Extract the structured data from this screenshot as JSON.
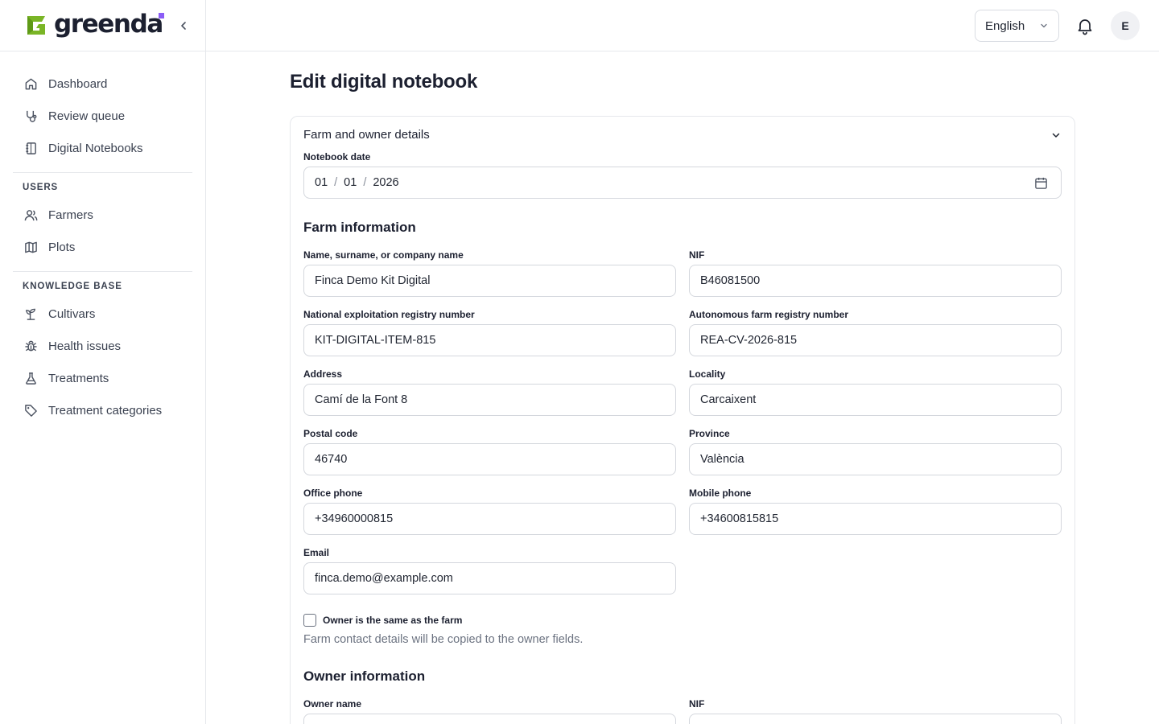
{
  "brand": {
    "name": "greenda",
    "accent": "#7ab526",
    "dot_color": "#8b5cf6"
  },
  "sidebar": {
    "collapse_icon": "chevron-left-icon",
    "items_top": [
      {
        "label": "Dashboard",
        "icon": "home-icon"
      },
      {
        "label": "Review queue",
        "icon": "stethoscope-icon"
      },
      {
        "label": "Digital Notebooks",
        "icon": "notebook-icon"
      }
    ],
    "users_section": "USERS",
    "users_items": [
      {
        "label": "Farmers",
        "icon": "users-icon"
      },
      {
        "label": "Plots",
        "icon": "map-icon"
      }
    ],
    "kb_section": "KNOWLEDGE BASE",
    "kb_items": [
      {
        "label": "Cultivars",
        "icon": "sprout-icon"
      },
      {
        "label": "Health issues",
        "icon": "bug-icon"
      },
      {
        "label": "Treatments",
        "icon": "flask-icon"
      },
      {
        "label": "Treatment categories",
        "icon": "tag-icon"
      }
    ]
  },
  "topbar": {
    "language": "English",
    "avatar_initial": "E"
  },
  "page": {
    "title": "Edit digital notebook"
  },
  "form": {
    "accordion_title": "Farm and owner details",
    "notebook_date_label": "Notebook date",
    "notebook_date": {
      "day": "01",
      "month": "01",
      "year": "2026"
    },
    "farm_section_title": "Farm information",
    "fields": {
      "name": {
        "label": "Name, surname, or company name",
        "value": "Finca Demo Kit Digital"
      },
      "nif": {
        "label": "NIF",
        "value": "B46081500"
      },
      "national_registry": {
        "label": "National exploitation registry number",
        "value": "KIT-DIGITAL-ITEM-815"
      },
      "autonomous_registry": {
        "label": "Autonomous farm registry number",
        "value": "REA-CV-2026-815"
      },
      "address": {
        "label": "Address",
        "value": "Camí de la Font 8"
      },
      "locality": {
        "label": "Locality",
        "value": "Carcaixent"
      },
      "postal_code": {
        "label": "Postal code",
        "value": "46740"
      },
      "province": {
        "label": "Province",
        "value": "València"
      },
      "office_phone": {
        "label": "Office phone",
        "value": "+34960000815"
      },
      "mobile_phone": {
        "label": "Mobile phone",
        "value": "+34600815815"
      },
      "email": {
        "label": "Email",
        "value": "finca.demo@example.com"
      }
    },
    "owner_same_label": "Owner is the same as the farm",
    "owner_same_checked": false,
    "owner_same_helper": "Farm contact details will be copied to the owner fields.",
    "owner_section_title": "Owner information",
    "owner_name_label": "Owner name",
    "owner_nif_label": "NIF"
  }
}
